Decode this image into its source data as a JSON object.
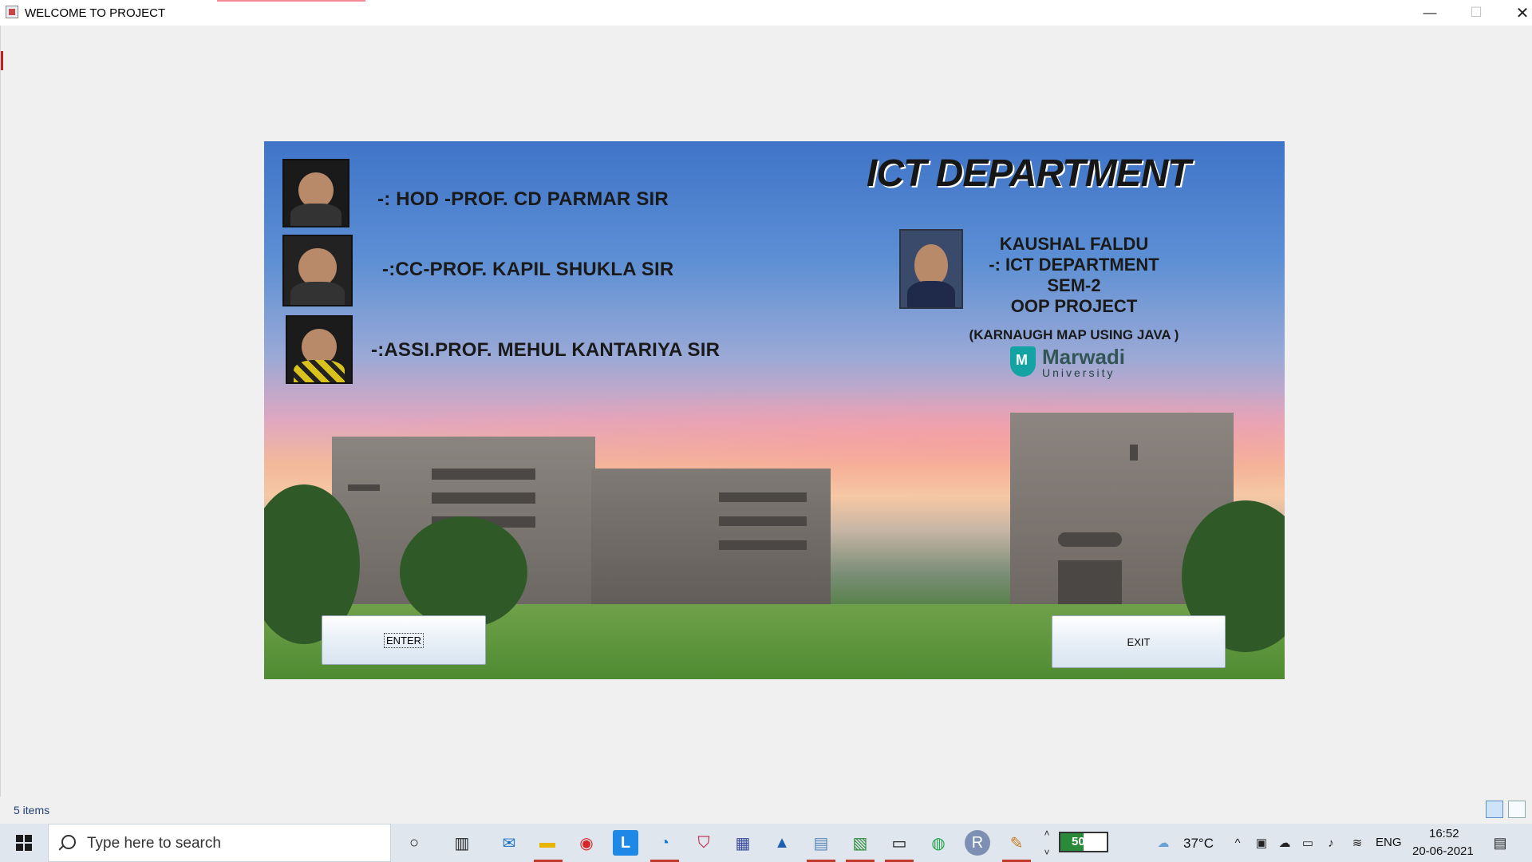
{
  "window": {
    "title": "WELCOME TO PROJECT",
    "minimize_glyph": "—",
    "maximize_glyph": "☐",
    "close_glyph": "✕"
  },
  "banner": {
    "department_title": "ICT DEPARTMENT",
    "faculty": [
      {
        "text": "-: HOD -PROF. CD PARMAR SIR"
      },
      {
        "text": "-:CC-PROF. KAPIL SHUKLA SIR"
      },
      {
        "text": "-:ASSI.PROF. MEHUL KANTARIYA SIR"
      }
    ],
    "student": {
      "name": "KAUSHAL FALDU",
      "line2": "-: ICT DEPARTMENT SEM-2",
      "line3": "OOP PROJECT",
      "project": "(KARNAUGH MAP USING JAVA )"
    },
    "logo": {
      "brand": "Marwadi",
      "sub": "University",
      "icon": "marwadi-shield-logo"
    },
    "enter_label": "ENTER",
    "exit_label": "EXIT"
  },
  "status_bar": {
    "items_label": "5 items"
  },
  "taskbar": {
    "search_placeholder": "Type here to search",
    "battery_percent": 50,
    "battery_label": "50%",
    "temperature": "37°C",
    "language": "ENG",
    "time": "16:52",
    "date": "20-06-2021",
    "pinned_icons": [
      "cortana-icon",
      "task-view-icon",
      "mail-icon",
      "file-explorer-icon",
      "opera-icon",
      "l-app-icon",
      "edge-icon",
      "mcafee-icon",
      "calculator-icon",
      "photos-icon",
      "notepad-icon",
      "excel-icon",
      "terminal-icon",
      "whatsapp-icon",
      "r-app-icon",
      "paint-icon"
    ]
  },
  "colors": {
    "battery_fill": "#2a8a3a",
    "taskbar_underline": "#c0392b",
    "logo_teal": "#14a3a3"
  }
}
